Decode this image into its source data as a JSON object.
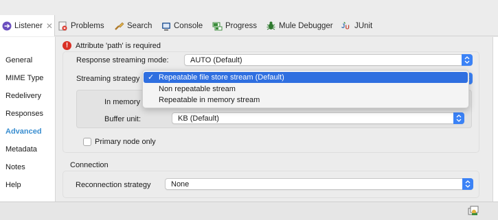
{
  "tabs": [
    {
      "label": "Listener",
      "icon": "listener-icon",
      "active": true,
      "close": "✕"
    },
    {
      "label": "Problems",
      "icon": "problems-icon"
    },
    {
      "label": "Search",
      "icon": "search-icon"
    },
    {
      "label": "Console",
      "icon": "console-icon"
    },
    {
      "label": "Progress",
      "icon": "progress-icon"
    },
    {
      "label": "Mule Debugger",
      "icon": "debug-icon"
    },
    {
      "label": "JUnit",
      "icon": "junit-icon"
    }
  ],
  "sidebar": {
    "items": [
      "General",
      "MIME Type",
      "Redelivery",
      "Responses",
      "Advanced",
      "Metadata",
      "Notes",
      "Help"
    ],
    "active": "Advanced"
  },
  "error": {
    "message": "Attribute 'path' is required"
  },
  "form": {
    "response_streaming_label": "Response streaming mode:",
    "response_streaming_value": "AUTO (Default)",
    "streaming_strategy_label": "Streaming strategy",
    "in_memory_label": "In memory",
    "buffer_unit_label": "Buffer unit:",
    "buffer_unit_value": "KB (Default)",
    "primary_node_label": "Primary node only"
  },
  "dropdown": {
    "options": [
      "Repeatable file store stream (Default)",
      "Non repeatable stream",
      "Repeatable in memory stream"
    ],
    "selected_index": 0,
    "check": "✓"
  },
  "connection": {
    "section_title": "Connection",
    "reconnection_label": "Reconnection strategy",
    "reconnection_value": "None"
  },
  "colors": {
    "accent": "#3b82f6",
    "selected": "#2f6fe0",
    "error": "#d93025",
    "active_nav": "#3a8ed0"
  }
}
